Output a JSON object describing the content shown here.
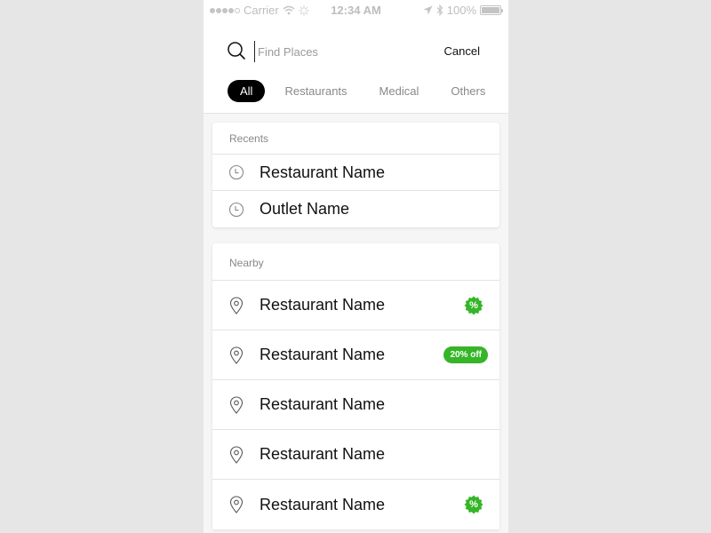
{
  "status_bar": {
    "carrier": "Carrier",
    "time": "12:34 AM",
    "battery": "100%",
    "icons": [
      "signal-dots-icon",
      "wifi-icon",
      "activity-spinner-icon",
      "location-arrow-icon",
      "bluetooth-icon",
      "battery-icon"
    ]
  },
  "search": {
    "placeholder": "Find Places",
    "value": "",
    "cancel_label": "Cancel"
  },
  "tabs": [
    {
      "label": "All",
      "active": true
    },
    {
      "label": "Restaurants",
      "active": false
    },
    {
      "label": "Medical",
      "active": false
    },
    {
      "label": "Others",
      "active": false
    }
  ],
  "recents": {
    "title": "Recents",
    "items": [
      {
        "label": "Restaurant Name",
        "icon": "clock-icon"
      },
      {
        "label": "Outlet Name",
        "icon": "clock-icon"
      }
    ]
  },
  "nearby": {
    "title": "Nearby",
    "items": [
      {
        "label": "Restaurant Name",
        "icon": "map-pin-icon",
        "badge": "%",
        "badge_type": "discount-seal"
      },
      {
        "label": "Restaurant Name",
        "icon": "map-pin-icon",
        "badge": "20% off",
        "badge_type": "pill"
      },
      {
        "label": "Restaurant Name",
        "icon": "map-pin-icon",
        "badge": null
      },
      {
        "label": "Restaurant Name",
        "icon": "map-pin-icon",
        "badge": null
      },
      {
        "label": "Restaurant Name",
        "icon": "map-pin-icon",
        "badge": "%",
        "badge_type": "discount-seal"
      }
    ]
  },
  "colors": {
    "accent_green": "#35b527",
    "active_tab_bg": "#000000",
    "background": "#f6f6f6",
    "muted_text": "#888888"
  }
}
